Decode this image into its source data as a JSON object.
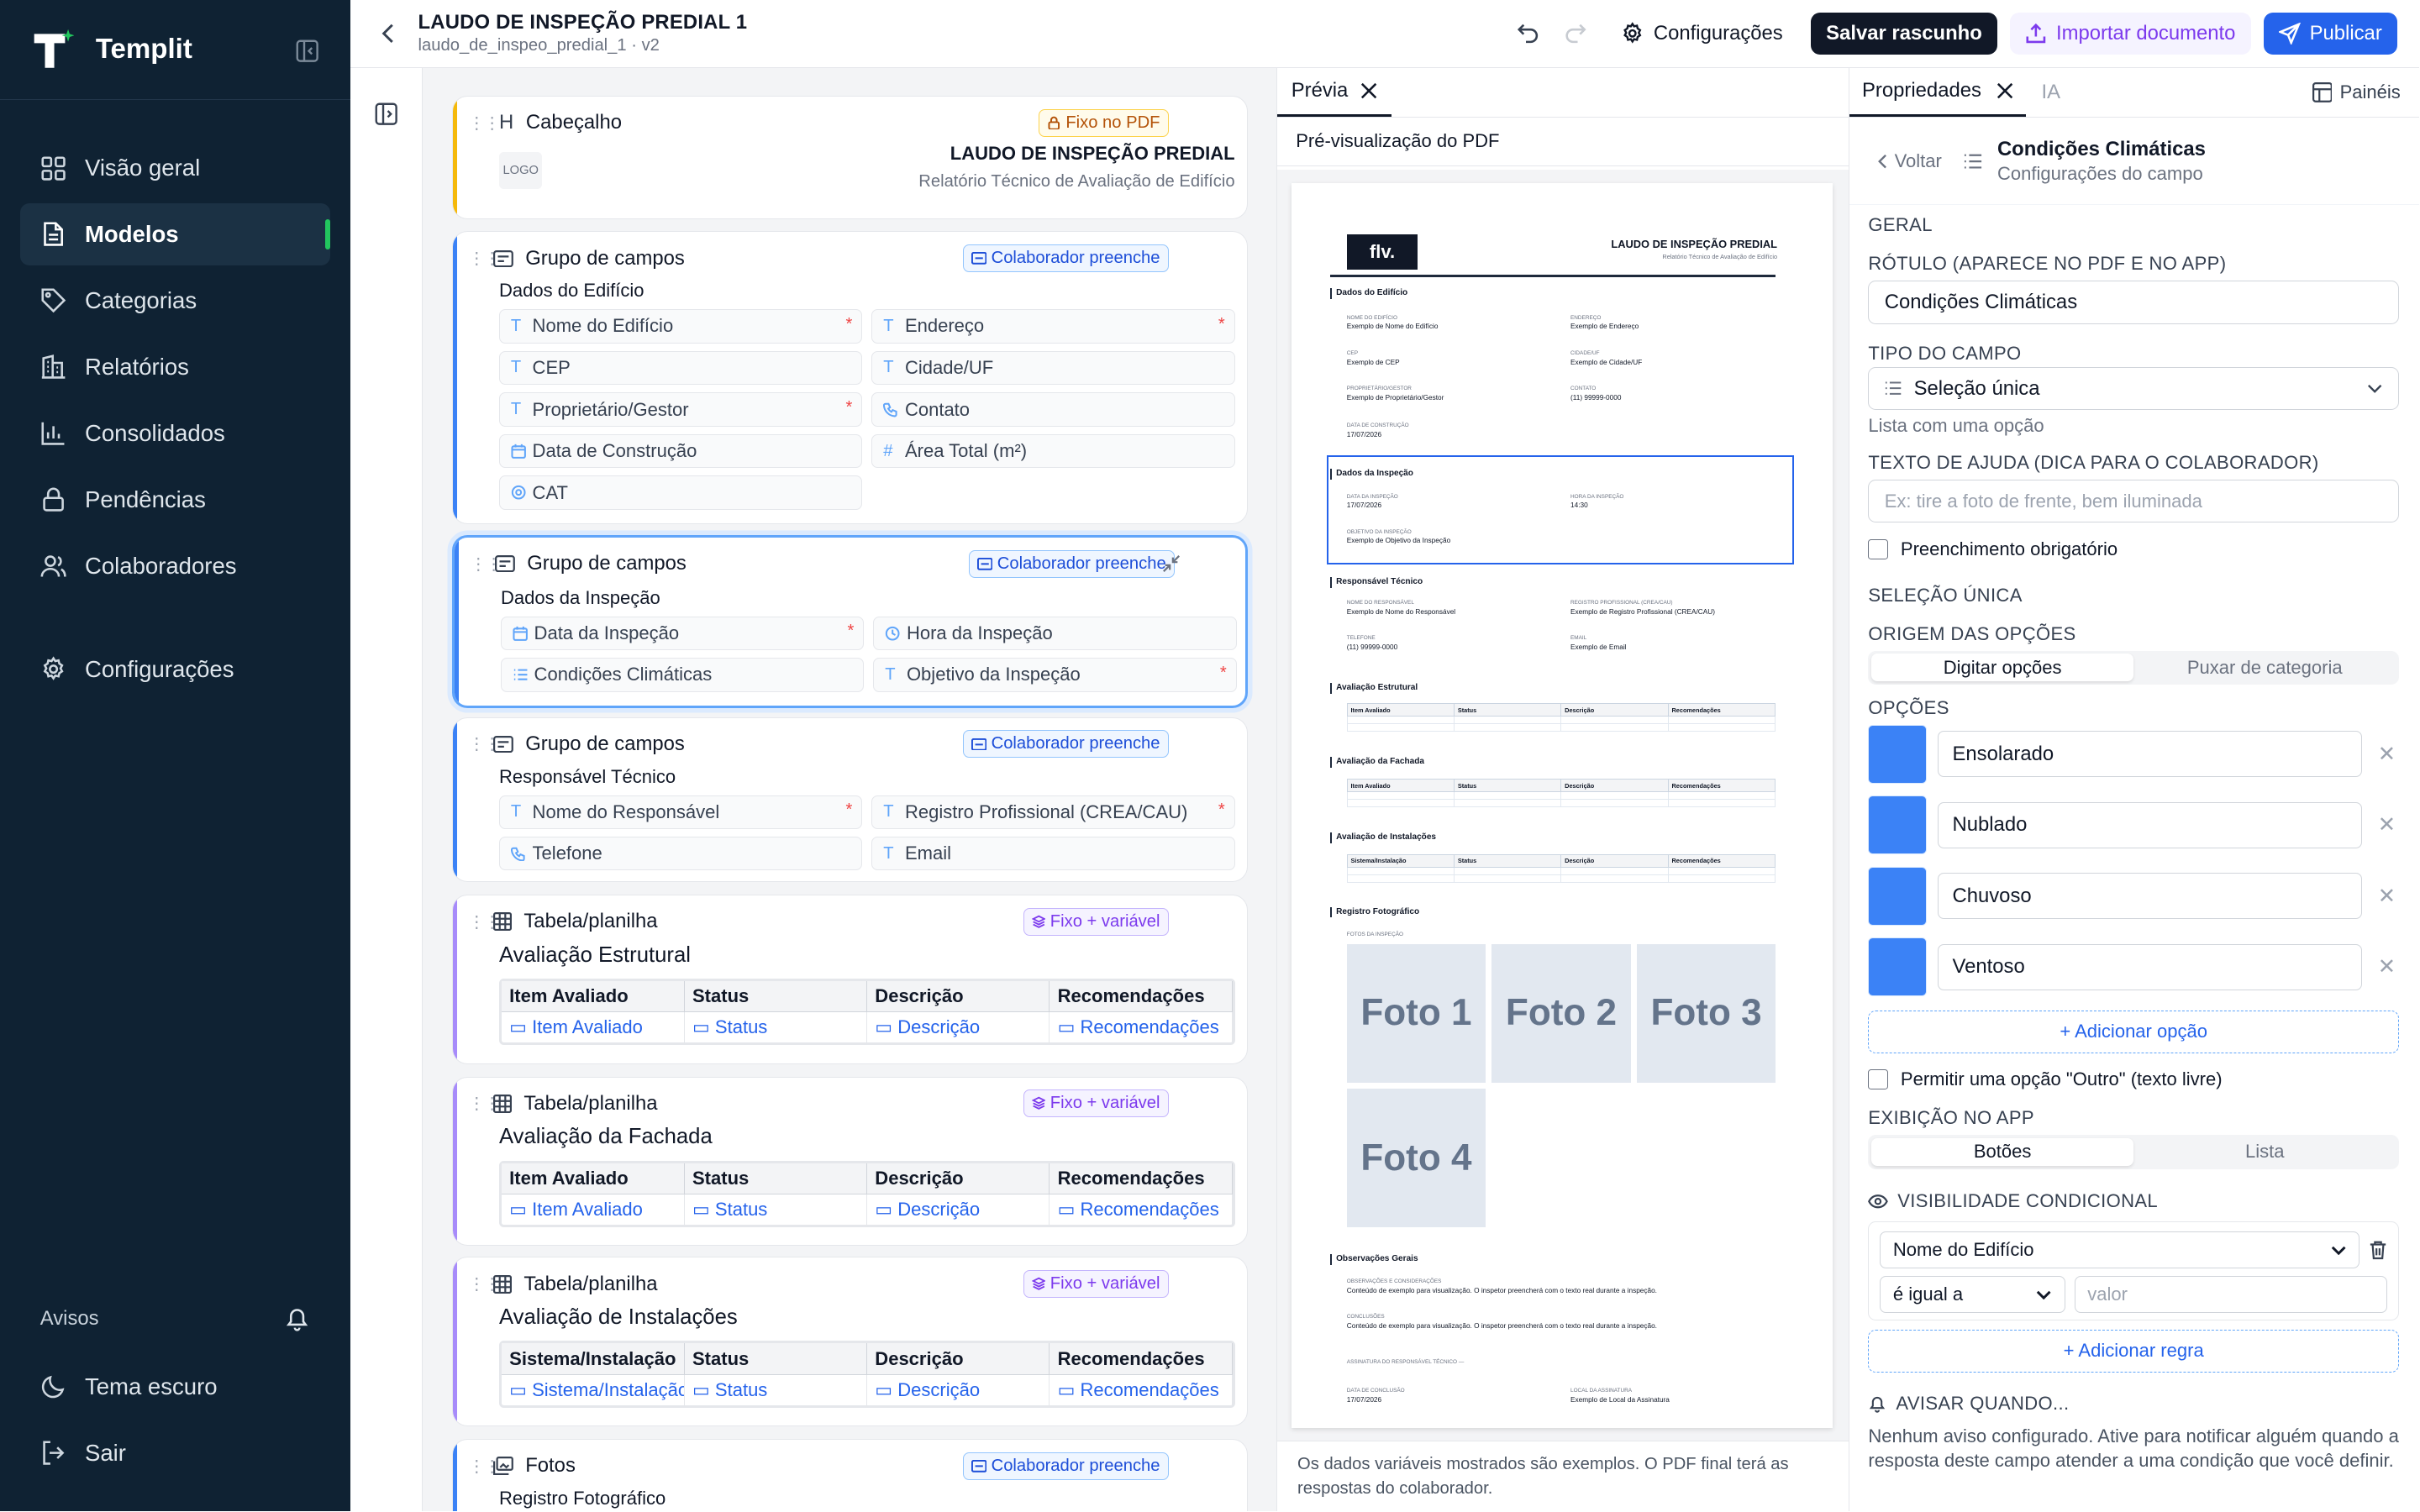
{
  "app": {
    "name": "Templit"
  },
  "sidebar": {
    "items": [
      {
        "label": "Visão geral",
        "icon": "grid-icon"
      },
      {
        "label": "Modelos",
        "icon": "document-icon",
        "active": true
      },
      {
        "label": "Categorias",
        "icon": "tag-icon"
      },
      {
        "label": "Relatórios",
        "icon": "building-icon"
      },
      {
        "label": "Consolidados",
        "icon": "bar-chart-icon"
      },
      {
        "label": "Pendências",
        "icon": "lock-icon"
      },
      {
        "label": "Colaboradores",
        "icon": "users-icon"
      }
    ],
    "settings": "Configurações",
    "notices": "Avisos",
    "dark_theme": "Tema escuro",
    "logout": "Sair",
    "accent": "#22c55e"
  },
  "topbar": {
    "title": "LAUDO DE INSPEÇÃO PREDIAL 1",
    "subtitle": "laudo_de_inspeo_predial_1 · v2",
    "settings": "Configurações",
    "save_draft": "Salvar rascunho",
    "import": "Importar documento",
    "publish": "Publicar"
  },
  "editor": {
    "header_card": {
      "type": "Cabeçalho",
      "badge": "Fixo no PDF",
      "logo": "LOGO",
      "title": "LAUDO DE INSPEÇÃO PREDIAL",
      "subtitle": "Relatório Técnico de Avaliação de Edifício"
    },
    "groups": [
      {
        "type": "Grupo de campos",
        "badge": "Colaborador preenche",
        "name": "Dados do Edifício",
        "fields": [
          {
            "label": "Nome do Edifício",
            "icon": "T",
            "required": true
          },
          {
            "label": "Endereço",
            "icon": "T",
            "required": true
          },
          {
            "label": "CEP",
            "icon": "T"
          },
          {
            "label": "Cidade/UF",
            "icon": "T"
          },
          {
            "label": "Proprietário/Gestor",
            "icon": "T",
            "required": true
          },
          {
            "label": "Contato",
            "icon": "phone"
          },
          {
            "label": "Data de Construção",
            "icon": "calendar"
          },
          {
            "label": "Área Total (m²)",
            "icon": "#"
          },
          {
            "label": "CAT",
            "icon": "badge"
          }
        ]
      },
      {
        "type": "Grupo de campos",
        "badge": "Colaborador preenche",
        "name": "Dados da Inspeção",
        "fields": [
          {
            "label": "Data da Inspeção",
            "icon": "calendar",
            "required": true
          },
          {
            "label": "Hora da Inspeção",
            "icon": "clock"
          },
          {
            "label": "Condições Climáticas",
            "icon": "list"
          },
          {
            "label": "Objetivo da Inspeção",
            "icon": "T",
            "required": true
          }
        ]
      },
      {
        "type": "Grupo de campos",
        "badge": "Colaborador preenche",
        "name": "Responsável Técnico",
        "fields": [
          {
            "label": "Nome do Responsável",
            "icon": "T",
            "required": true
          },
          {
            "label": "Registro Profissional (CREA/CAU)",
            "icon": "T",
            "required": true
          },
          {
            "label": "Telefone",
            "icon": "phone"
          },
          {
            "label": "Email",
            "icon": "T"
          }
        ]
      }
    ],
    "tables": [
      {
        "type": "Tabela/planilha",
        "badge": "Fixo + variável",
        "name": "Avaliação Estrutural",
        "columns": [
          "Item Avaliado",
          "Status",
          "Descrição",
          "Recomendações"
        ],
        "cells": [
          "Item Avaliado",
          "Status",
          "Descrição",
          "Recomendações"
        ]
      },
      {
        "type": "Tabela/planilha",
        "badge": "Fixo + variável",
        "name": "Avaliação da Fachada",
        "columns": [
          "Item Avaliado",
          "Status",
          "Descrição",
          "Recomendações"
        ],
        "cells": [
          "Item Avaliado",
          "Status",
          "Descrição",
          "Recomendações"
        ]
      },
      {
        "type": "Tabela/planilha",
        "badge": "Fixo + variável",
        "name": "Avaliação de Instalações",
        "columns": [
          "Sistema/Instalação",
          "Status",
          "Descrição",
          "Recomendações"
        ],
        "cells": [
          "Sistema/Instalação",
          "Status",
          "Descrição",
          "Recomendações"
        ]
      }
    ],
    "photos_card": {
      "type": "Fotos",
      "badge": "Colaborador preenche",
      "name": "Registro Fotográfico"
    }
  },
  "preview": {
    "tab": "Prévia",
    "subtitle": "Pré-visualização do PDF",
    "footer": "Os dados variáveis mostrados são exemplos. O PDF final terá as respostas do colaborador.",
    "pdf": {
      "logo": "flv.",
      "title": "LAUDO DE INSPEÇÃO PREDIAL",
      "subtitle": "Relatório Técnico de Avaliação de Edifício",
      "sec_building": "Dados do Edifício",
      "b1k": "Nome do Edifício",
      "b1v": "Exemplo de Nome do Edifício",
      "b2k": "Endereço",
      "b2v": "Exemplo de Endereço",
      "b3k": "CEP",
      "b3v": "Exemplo de CEP",
      "b4k": "Cidade/UF",
      "b4v": "Exemplo de Cidade/UF",
      "b5k": "Proprietário/Gestor",
      "b5v": "Exemplo de Proprietário/Gestor",
      "b6k": "Contato",
      "b6v": "(11) 99999-0000",
      "b7k": "Data de Construção",
      "b7v": "17/07/2026",
      "sec_inspection": "Dados da Inspeção",
      "i1k": "Data da Inspeção",
      "i1v": "17/07/2026",
      "i2k": "Hora da Inspeção",
      "i2v": "14:30",
      "i3k": "Objetivo da Inspeção",
      "i3v": "Exemplo de Objetivo da Inspeção",
      "sec_resp": "Responsável Técnico",
      "r1k": "Nome do Responsável",
      "r1v": "Exemplo de Nome do Responsável",
      "r2k": "Registro Profissional (CREA/CAU)",
      "r2v": "Exemplo de Registro Profissional (CREA/CAU)",
      "r3k": "Telefone",
      "r3v": "(11) 99999-0000",
      "r4k": "Email",
      "r4v": "Exemplo de Email",
      "sec_t1": "Avaliação Estrutural",
      "sec_t2": "Avaliação da Fachada",
      "sec_t3": "Avaliação de Instalações",
      "t_cols": [
        "Item Avaliado",
        "Status",
        "Descrição",
        "Recomendações"
      ],
      "t3_cols": [
        "Sistema/Instalação",
        "Status",
        "Descrição",
        "Recomendações"
      ],
      "sec_photos": "Registro Fotográfico",
      "photos_label": "Fotos da inspeção",
      "photos": [
        "Foto 1",
        "Foto 2",
        "Foto 3",
        "Foto 4"
      ],
      "sec_obs": "Observações Gerais",
      "o1k": "Observações e considerações",
      "o1v": "Conteúdo de exemplo para visualização. O inspetor preencherá com o texto real durante a inspeção.",
      "o2k": "Conclusões",
      "o2v": "Conteúdo de exemplo para visualização. O inspetor preencherá com o texto real durante a inspeção.",
      "o3k": "Assinatura do responsável técnico —",
      "o4k": "Data de conclusão",
      "o4v": "17/07/2026",
      "o5k": "Local da assinatura",
      "o5v": "Exemplo de Local da Assinatura"
    }
  },
  "properties": {
    "tab": "Propriedades",
    "tab_ia": "IA",
    "panels": "Painéis",
    "back": "Voltar",
    "title": "Condições Climáticas",
    "subtitle": "Configurações do campo",
    "general": "GERAL",
    "label_title": "RÓTULO (APARECE NO PDF E NO APP)",
    "label_value": "Condições Climáticas",
    "type_title": "TIPO DO CAMPO",
    "type_value": "Seleção única",
    "type_hint": "Lista com uma opção",
    "help_title": "TEXTO DE AJUDA (DICA PARA O COLABORADOR)",
    "help_placeholder": "Ex: tire a foto de frente, bem iluminada",
    "required": "Preenchimento obrigatório",
    "single_sel": "SELEÇÃO ÚNICA",
    "origin_title": "ORIGEM DAS OPÇÕES",
    "origin_a": "Digitar opções",
    "origin_b": "Puxar de categoria",
    "options_title": "OPÇÕES",
    "options": [
      "Ensolarado",
      "Nublado",
      "Chuvoso",
      "Ventoso"
    ],
    "option_color": "#3b82f6",
    "add_option": "+ Adicionar opção",
    "allow_other": "Permitir uma opção \"Outro\" (texto livre)",
    "display_title": "EXIBIÇÃO NO APP",
    "display_a": "Botões",
    "display_b": "Lista",
    "visibility": "VISIBILIDADE CONDICIONAL",
    "cond_field": "Nome do Edifício",
    "cond_op": "é igual a",
    "cond_value_ph": "valor",
    "add_rule": "+ Adicionar regra",
    "notify_title": "AVISAR QUANDO...",
    "notify_text": "Nenhum aviso configurado. Ative para notificar alguém quando a resposta deste campo atender a uma condição que você definir."
  }
}
